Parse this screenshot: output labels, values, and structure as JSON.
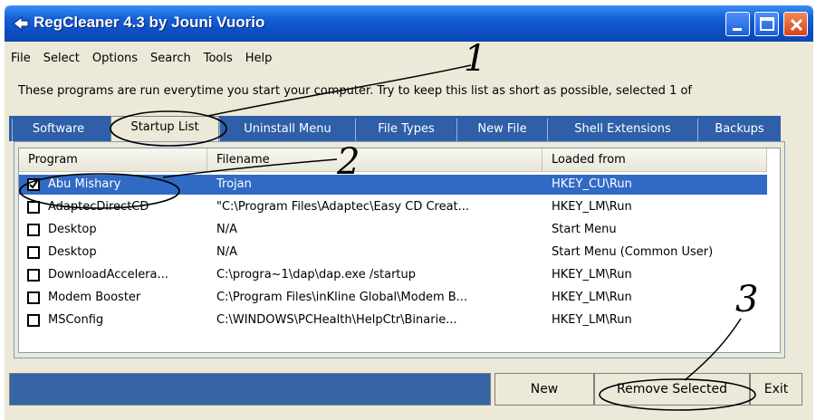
{
  "window": {
    "title": "RegCleaner 4.3 by Jouni Vuorio"
  },
  "title_buttons": [
    "minimize-icon",
    "maximize-icon",
    "close-icon"
  ],
  "menu": [
    "File",
    "Select",
    "Options",
    "Search",
    "Tools",
    "Help"
  ],
  "info_text": "These programs are run everytime you start your computer. Try to keep this list as short as possible, selected 1 of",
  "tabs": [
    "Software",
    "Startup List",
    "Uninstall Menu",
    "File Types",
    "New File",
    "Shell Extensions",
    "Backups"
  ],
  "active_tab": "Startup List",
  "list": {
    "columns": [
      "Program",
      "Filename",
      "Loaded from"
    ],
    "rows": [
      {
        "checked": true,
        "selected": true,
        "program": "Abu Mishary",
        "filename": "Trojan",
        "loaded_from": "HKEY_CU\\Run"
      },
      {
        "checked": false,
        "selected": false,
        "program": "AdaptecDirectCD",
        "filename": "\"C:\\Program Files\\Adaptec\\Easy CD Creat...",
        "loaded_from": "HKEY_LM\\Run"
      },
      {
        "checked": false,
        "selected": false,
        "program": "Desktop",
        "filename": "N/A",
        "loaded_from": "Start Menu"
      },
      {
        "checked": false,
        "selected": false,
        "program": "Desktop",
        "filename": "N/A",
        "loaded_from": "Start Menu (Common User)"
      },
      {
        "checked": false,
        "selected": false,
        "program": "DownloadAccelera...",
        "filename": "C:\\progra~1\\dap\\dap.exe /startup",
        "loaded_from": "HKEY_LM\\Run"
      },
      {
        "checked": false,
        "selected": false,
        "program": "Modem Booster",
        "filename": "C:\\Program Files\\inKline Global\\Modem B...",
        "loaded_from": "HKEY_LM\\Run"
      },
      {
        "checked": false,
        "selected": false,
        "program": "MSConfig",
        "filename": "C:\\WINDOWS\\PCHealth\\HelpCtr\\Binarie...",
        "loaded_from": "HKEY_LM\\Run"
      }
    ]
  },
  "buttons": {
    "new": "New",
    "remove": "Remove Selected",
    "exit": "Exit"
  },
  "annotations": [
    "1",
    "2",
    "3"
  ],
  "colors": {
    "title_blue": "#0d4fc4",
    "selection": "#316ac5",
    "tab_strip": "#2e5fa8",
    "status_panel": "#3565a5"
  }
}
